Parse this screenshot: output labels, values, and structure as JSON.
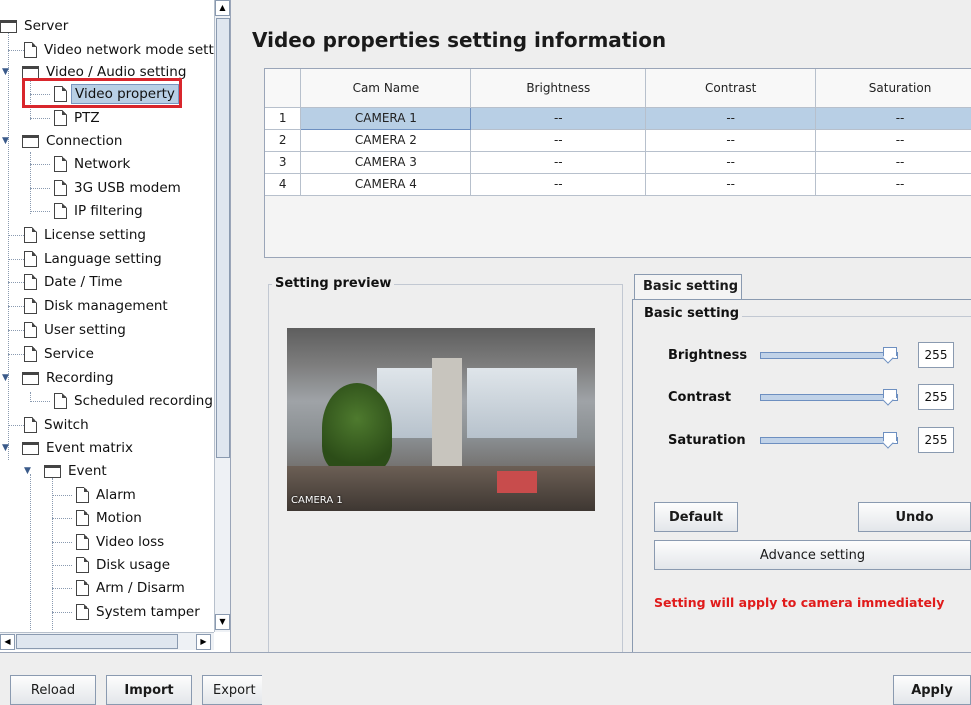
{
  "tree": {
    "items": [
      {
        "label": "Server",
        "icon": "folder-icon"
      },
      {
        "label": "Video network mode setti",
        "icon": "document-icon"
      },
      {
        "label": "Video / Audio setting",
        "icon": "folder-icon"
      },
      {
        "label": "Video property",
        "icon": "document-icon",
        "selected": true
      },
      {
        "label": "PTZ",
        "icon": "document-icon"
      },
      {
        "label": "Connection",
        "icon": "folder-icon"
      },
      {
        "label": "Network",
        "icon": "document-icon"
      },
      {
        "label": "3G USB modem",
        "icon": "document-icon"
      },
      {
        "label": "IP filtering",
        "icon": "document-icon"
      },
      {
        "label": "License setting",
        "icon": "document-icon"
      },
      {
        "label": "Language setting",
        "icon": "document-icon"
      },
      {
        "label": "Date / Time",
        "icon": "document-icon"
      },
      {
        "label": "Disk management",
        "icon": "document-icon"
      },
      {
        "label": "User setting",
        "icon": "document-icon"
      },
      {
        "label": "Service",
        "icon": "document-icon"
      },
      {
        "label": "Recording",
        "icon": "folder-icon"
      },
      {
        "label": "Scheduled recording",
        "icon": "document-icon"
      },
      {
        "label": "Switch",
        "icon": "document-icon"
      },
      {
        "label": "Event matrix",
        "icon": "folder-icon"
      },
      {
        "label": "Event",
        "icon": "folder-icon"
      },
      {
        "label": "Alarm",
        "icon": "document-icon"
      },
      {
        "label": "Motion",
        "icon": "document-icon"
      },
      {
        "label": "Video loss",
        "icon": "document-icon"
      },
      {
        "label": "Disk usage",
        "icon": "document-icon"
      },
      {
        "label": "Arm / Disarm",
        "icon": "document-icon"
      },
      {
        "label": "System tamper",
        "icon": "document-icon"
      }
    ]
  },
  "main": {
    "title": "Video properties setting information",
    "table": {
      "columns": [
        "",
        "Cam Name",
        "Brightness",
        "Contrast",
        "Saturation"
      ],
      "rows": [
        {
          "index": "1",
          "name": "CAMERA 1",
          "brightness": "--",
          "contrast": "--",
          "saturation": "--"
        },
        {
          "index": "2",
          "name": "CAMERA 2",
          "brightness": "--",
          "contrast": "--",
          "saturation": "--"
        },
        {
          "index": "3",
          "name": "CAMERA 3",
          "brightness": "--",
          "contrast": "--",
          "saturation": "--"
        },
        {
          "index": "4",
          "name": "CAMERA 4",
          "brightness": "--",
          "contrast": "--",
          "saturation": "--"
        }
      ]
    },
    "preview": {
      "group_title": "Setting preview",
      "camera_label": "CAMERA 1"
    },
    "settings": {
      "tab_label": "Basic setting",
      "group_title": "Basic setting",
      "brightness_label": "Brightness",
      "brightness_value": "255",
      "contrast_label": "Contrast",
      "contrast_value": "255",
      "saturation_label": "Saturation",
      "saturation_value": "255",
      "default_label": "Default",
      "undo_label": "Undo",
      "advance_label": "Advance setting",
      "notice": "Setting will apply to camera immediately",
      "slider_max": 255,
      "notice_color": "#e01b1b"
    }
  },
  "bottom": {
    "reload_label": "Reload",
    "import_label": "Import",
    "export_label": "Export",
    "apply_label": "Apply"
  }
}
